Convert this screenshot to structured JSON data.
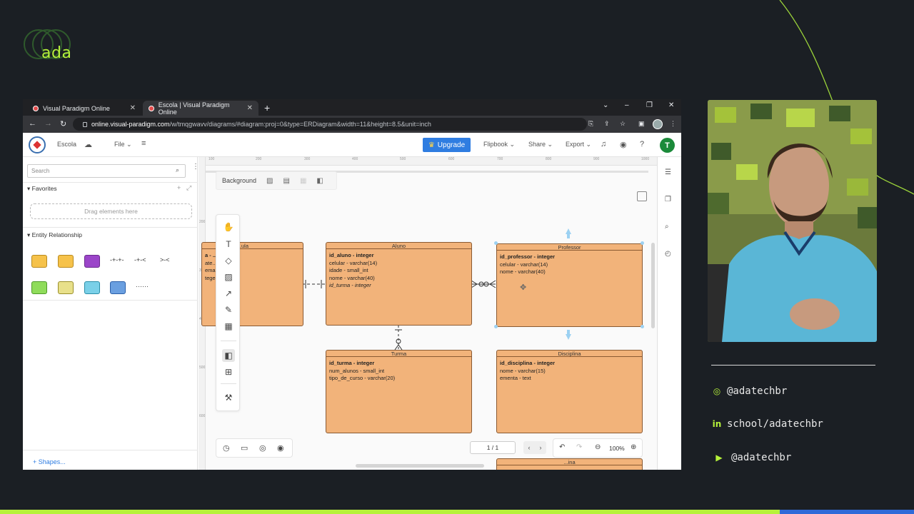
{
  "brand": {
    "name": "ada",
    "accent": "#b6f23a"
  },
  "browser": {
    "tabs": [
      {
        "label": "Visual Paradigm Online",
        "active": false
      },
      {
        "label": "Escola | Visual Paradigm Online",
        "active": true
      }
    ],
    "url_host": "online.visual-paradigm.com",
    "url_path": "/w/tmqgwavv/diagrams/#diagram:proj=0&type=ERDiagram&width=11&height=8.5&unit=inch"
  },
  "app": {
    "project_name": "Escola",
    "file_menu": "File",
    "upgrade_label": "Upgrade",
    "menus": {
      "flipbook": "Flipbook",
      "share": "Share",
      "export": "Export"
    },
    "user_initial": "T"
  },
  "left_panel": {
    "search_placeholder": "Search",
    "favorites_label": "Favorites",
    "drop_label": "Drag elements here",
    "entity_relationship_label": "Entity Relationship",
    "shapes_link": "Shapes..."
  },
  "canvas": {
    "background_label": "Background",
    "ruler_ticks": [
      "100",
      "200",
      "300",
      "400",
      "500",
      "600",
      "700",
      "800",
      "900",
      "1000"
    ],
    "ruler_v_ticks": [
      "200",
      "300",
      "400",
      "500",
      "600"
    ],
    "page_indicator": "1 / 1",
    "zoom": "100%"
  },
  "entities": {
    "partial": {
      "title": "...ula",
      "rows": [
        "a - ...",
        "ate...",
        "ema...        ...eal",
        "tege..."
      ]
    },
    "aluno": {
      "title": "Aluno",
      "pk": "id_aluno - integer",
      "rows": [
        "celular - varchar(14)",
        "idade - small_int",
        "nome - varchar(40)"
      ],
      "fk": "id_turma - integer"
    },
    "professor": {
      "title": "Professor",
      "pk": "id_professor - integer",
      "rows": [
        "celular - varchar(14)",
        "nome - varchar(40)"
      ]
    },
    "turma": {
      "title": "Turma",
      "pk": "id_turma - integer",
      "rows": [
        "num_alunos - small_int",
        "tipo_de_curso - varchar(20)"
      ]
    },
    "disciplina": {
      "title": "Disciplina",
      "pk": "id_disciplina - integer",
      "rows": [
        "nome - varchar(15)",
        "ementa - text"
      ]
    },
    "bottom_partial": {
      "title": "...ina"
    }
  },
  "social": {
    "instagram": "@adatechbr",
    "linkedin": "school/adatechbr",
    "youtube": "@adatechbr"
  }
}
